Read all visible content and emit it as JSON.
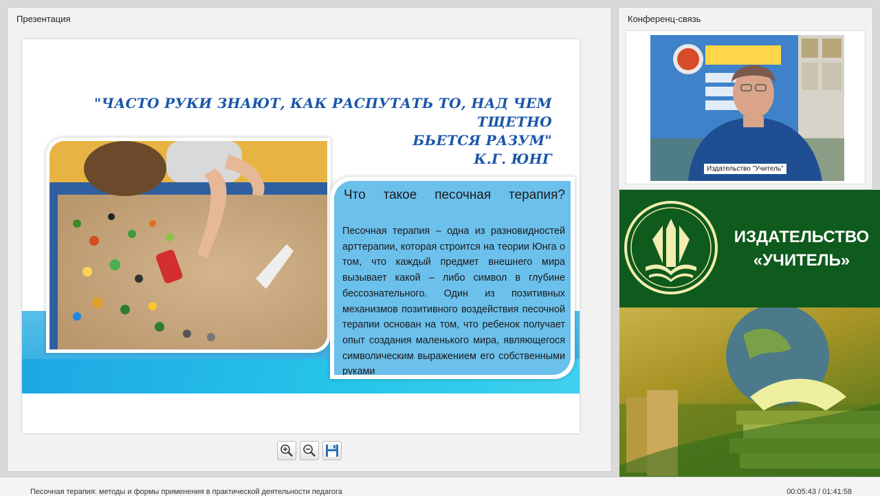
{
  "presentation_panel": {
    "title": "Презентация"
  },
  "conference_panel": {
    "title": "Конференц-связь",
    "camera_caption": "Издательство \"Учитель\""
  },
  "slide": {
    "quote_line1": "\"ЧАСТО РУКИ ЗНАЮТ, КАК РАСПУТАТЬ ТО, НАД ЧЕМ ТЩЕТНО",
    "quote_line2": "БЬЕТСЯ РАЗУМ\"",
    "quote_author": "К.Г. ЮНГ",
    "box_title": "Что такое песочная терапия?",
    "box_text": "Песочная терапия – одна из разновидностей арттерапии, которая строится на теории Юнга о том, что каждый предмет внешнего мира вызывает какой – либо символ в глубине бессознательного. Один из позитивных механизмов позитивного воздействия песочной терапии основан на том, что ребенок получает опыт создания маленького мира, являющегося символическим выражением его собственными руками"
  },
  "toolbar": {
    "zoom_in": "zoom-in-icon",
    "zoom_out": "zoom-out-icon",
    "save": "save-icon"
  },
  "publisher": {
    "line1": "ИЗДАТЕЛЬСТВО",
    "line2": "«УЧИТЕЛЬ»"
  },
  "footer": {
    "title": "Песочная терапия: методы и формы применения в практической деятельности педагога",
    "time": "00:05:43 / 01:41:58"
  },
  "colors": {
    "quote": "#1a56a8",
    "box": "#6cc0ec",
    "band": "#2aa7e0",
    "publisher_green": "#0f5a1d"
  }
}
